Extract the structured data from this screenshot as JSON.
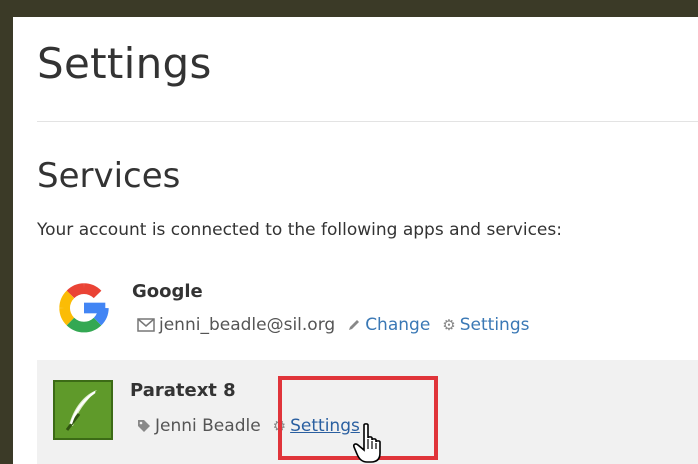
{
  "page": {
    "title": "Settings"
  },
  "services": {
    "heading": "Services",
    "intro": "Your account is connected to the following apps and services:",
    "items": [
      {
        "name": "Google",
        "icon": "google-logo-icon",
        "account_icon": "envelope-icon",
        "account": "jenni_beadle@sil.org",
        "change_label": "Change",
        "settings_label": "Settings"
      },
      {
        "name": "Paratext 8",
        "icon": "paratext-quill-icon",
        "account_icon": "tag-icon",
        "account": "Jenni Beadle",
        "settings_label": "Settings"
      }
    ]
  },
  "colors": {
    "frame": "#3b3a27",
    "link": "#3a78b5",
    "highlight": "#e0343a",
    "selected_row": "#f1f1f1"
  }
}
